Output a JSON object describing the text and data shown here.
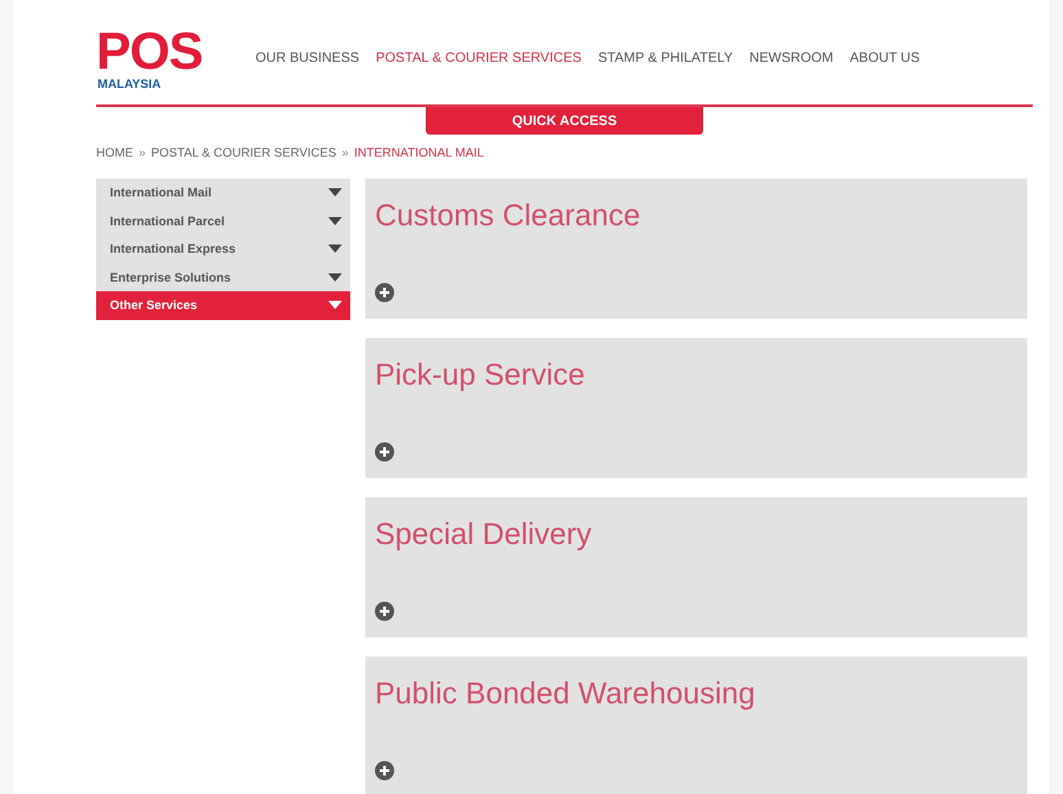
{
  "logo": {
    "mark": "POS",
    "sub": "MALAYSIA"
  },
  "nav": [
    {
      "label": "OUR BUSINESS",
      "selected": false
    },
    {
      "label": "POSTAL & COURIER SERVICES",
      "selected": true
    },
    {
      "label": "STAMP & PHILATELY",
      "selected": false
    },
    {
      "label": "NEWSROOM",
      "selected": false
    },
    {
      "label": "ABOUT US",
      "selected": false
    }
  ],
  "quick_access": "QUICK ACCESS",
  "breadcrumb": [
    {
      "label": "HOME",
      "current": false
    },
    {
      "label": "POSTAL & COURIER SERVICES",
      "current": false
    },
    {
      "label": "INTERNATIONAL MAIL",
      "current": true
    }
  ],
  "breadcrumb_separator": "»",
  "sidebar": [
    {
      "label": "International Mail",
      "selected": false
    },
    {
      "label": "International Parcel",
      "selected": false
    },
    {
      "label": "International Express",
      "selected": false
    },
    {
      "label": "Enterprise Solutions",
      "selected": false
    },
    {
      "label": "Other Services",
      "selected": true
    }
  ],
  "services": [
    {
      "title": "Customs Clearance",
      "expanded": false
    },
    {
      "title": "Pick-up Service",
      "expanded": false
    },
    {
      "title": "Special Delivery",
      "expanded": false
    },
    {
      "title": "Public Bonded Warehousing",
      "expanded": false
    }
  ]
}
